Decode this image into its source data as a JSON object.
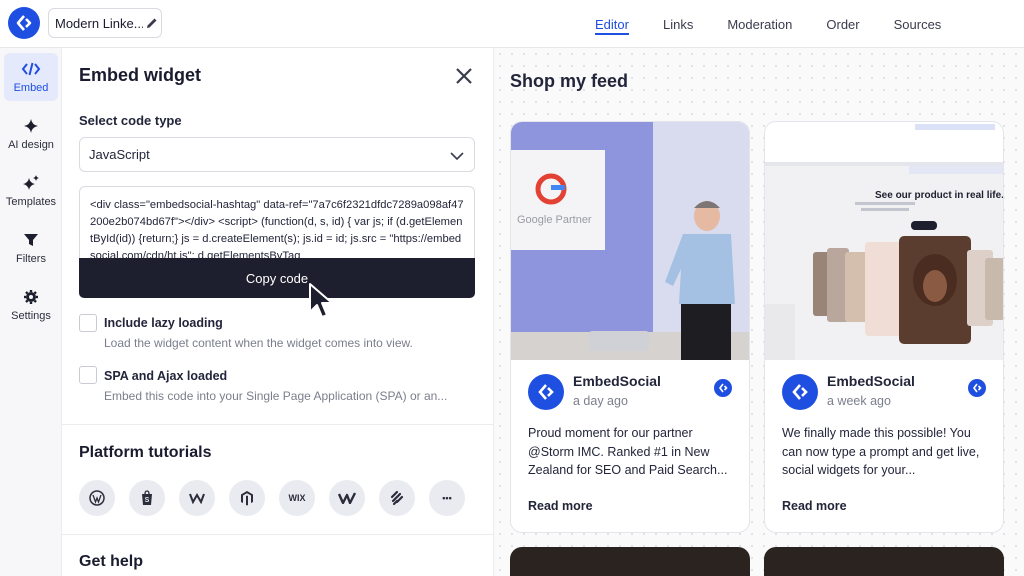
{
  "header": {
    "project_title": "Modern Linke...",
    "tabs": [
      {
        "label": "Editor",
        "active": true
      },
      {
        "label": "Links"
      },
      {
        "label": "Moderation"
      },
      {
        "label": "Order"
      },
      {
        "label": "Sources"
      }
    ]
  },
  "sidebar": {
    "items": [
      {
        "label": "Embed",
        "icon": "code-icon",
        "active": true
      },
      {
        "label": "AI design",
        "icon": "sparkle-icon"
      },
      {
        "label": "Templates",
        "icon": "sparkles-icon"
      },
      {
        "label": "Filters",
        "icon": "filter-icon"
      },
      {
        "label": "Settings",
        "icon": "gear-icon"
      }
    ]
  },
  "embed": {
    "title": "Embed widget",
    "code_type_label": "Select code type",
    "code_type_value": "JavaScript",
    "code": "<div class=\"embedsocial-hashtag\" data-ref=\"7a7c6f2321dfdc7289a098af47200e2b074bd67f\"></div> <script> (function(d, s, id) { var js; if (d.getElementById(id)) {return;} js = d.createElement(s); js.id = id; js.src = \"https://embedsocial.com/cdn/ht.js\"; d.getElementsByTag",
    "copy_label": "Copy code",
    "lazy_title": "Include lazy loading",
    "lazy_desc": "Load the widget content when the widget comes into view.",
    "spa_title": "SPA and Ajax loaded",
    "spa_desc": "Embed this code into your Single Page Application (SPA) or an..."
  },
  "tutorials": {
    "title": "Platform tutorials",
    "platforms": [
      {
        "icon": "wordpress-icon",
        "glyph": "W"
      },
      {
        "icon": "shopify-icon",
        "glyph": ""
      },
      {
        "icon": "weebly-icon",
        "glyph": "W"
      },
      {
        "icon": "magento-icon",
        "glyph": ""
      },
      {
        "icon": "wix-icon",
        "glyph": "WIX"
      },
      {
        "icon": "webflow-icon",
        "glyph": ""
      },
      {
        "icon": "squarespace-icon",
        "glyph": ""
      },
      {
        "icon": "more-icon",
        "glyph": "•••"
      }
    ]
  },
  "help": {
    "title": "Get help"
  },
  "feed": {
    "title": "Shop my feed",
    "cards": [
      {
        "name": "EmbedSocial",
        "time": "a day ago",
        "text": "Proud moment for our partner @Storm IMC. Ranked #1 in New Zealand for SEO and Paid Search...",
        "read_more": "Read more",
        "image_caption": "Google Partner"
      },
      {
        "name": "EmbedSocial",
        "time": "a week ago",
        "text": "We finally made this possible! You can now type a prompt and get live, social widgets for your...",
        "read_more": "Read more",
        "image_caption": "See our product in real life."
      }
    ]
  },
  "colors": {
    "accent": "#1f4fe0",
    "dark_button": "#1e1f2e"
  }
}
